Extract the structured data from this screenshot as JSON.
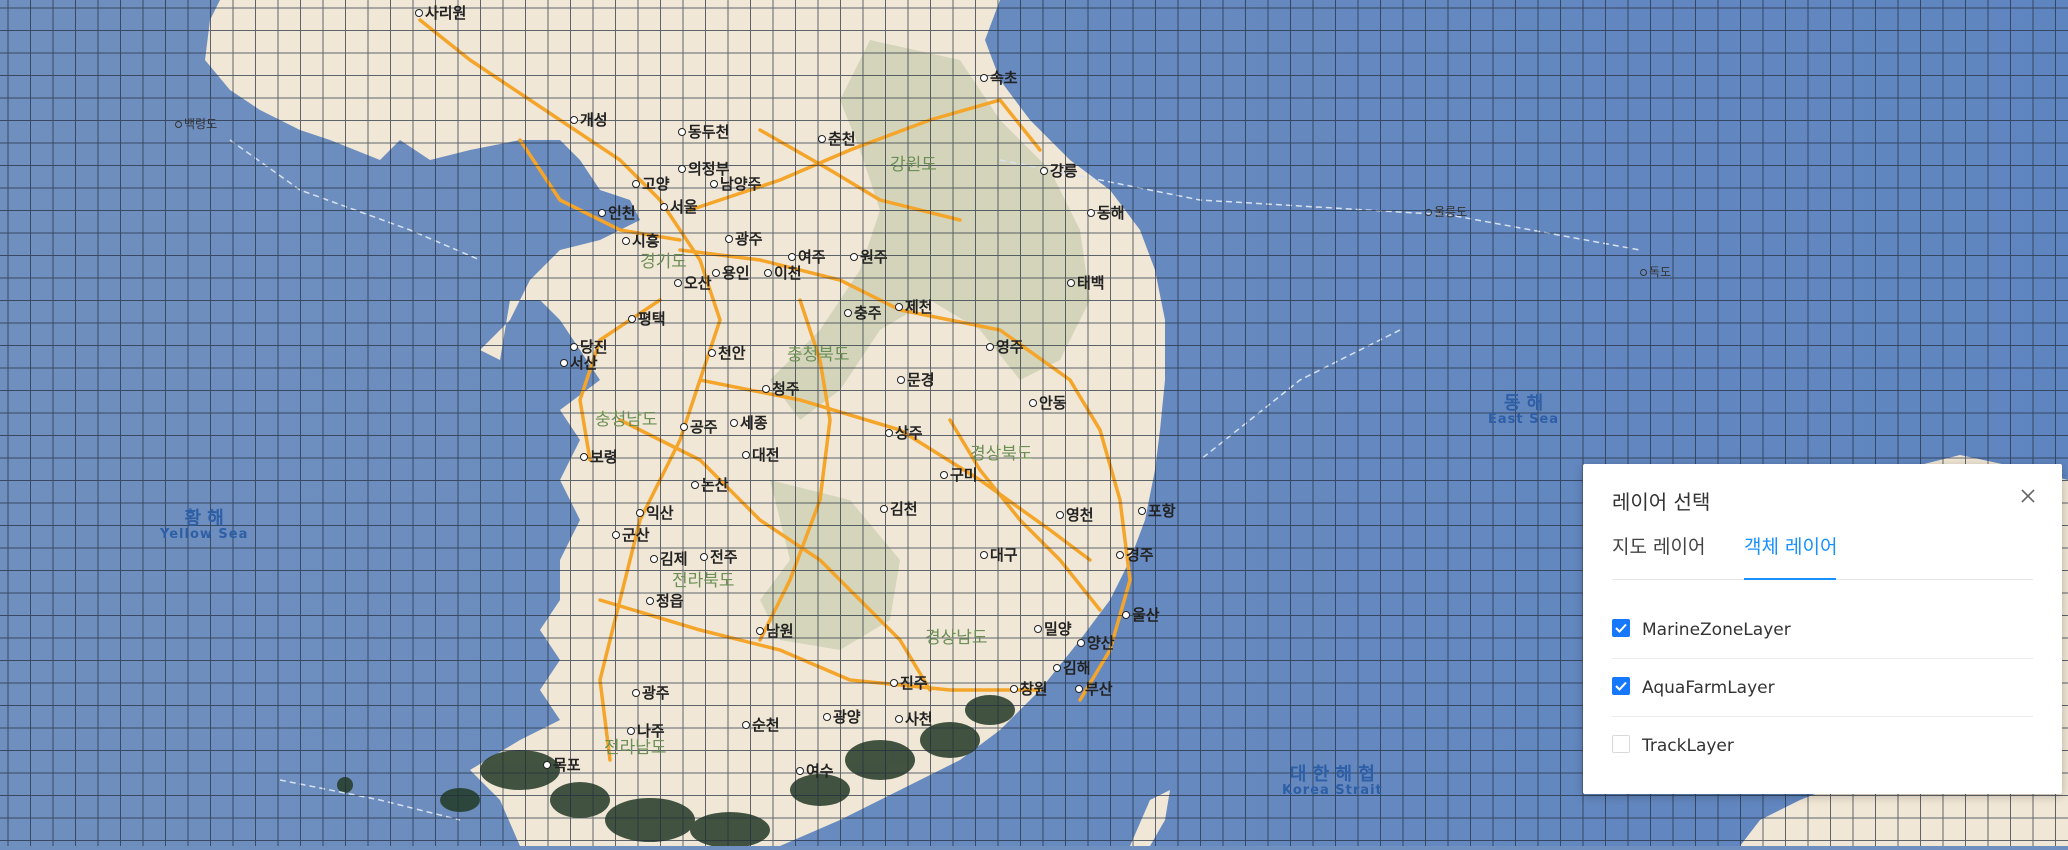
{
  "map": {
    "cities": [
      {
        "name": "사리원"
      },
      {
        "name": "개성"
      },
      {
        "name": "동두천"
      },
      {
        "name": "춘천"
      },
      {
        "name": "속초"
      },
      {
        "name": "의정부"
      },
      {
        "name": "고양"
      },
      {
        "name": "남양주"
      },
      {
        "name": "강릉"
      },
      {
        "name": "인천"
      },
      {
        "name": "서울"
      },
      {
        "name": "동해"
      },
      {
        "name": "시흥"
      },
      {
        "name": "광주"
      },
      {
        "name": "여주"
      },
      {
        "name": "원주"
      },
      {
        "name": "오산"
      },
      {
        "name": "용인"
      },
      {
        "name": "이천"
      },
      {
        "name": "태백"
      },
      {
        "name": "평택"
      },
      {
        "name": "충주"
      },
      {
        "name": "제천"
      },
      {
        "name": "당진"
      },
      {
        "name": "천안"
      },
      {
        "name": "영주"
      },
      {
        "name": "서산"
      },
      {
        "name": "청주"
      },
      {
        "name": "문경"
      },
      {
        "name": "안동"
      },
      {
        "name": "공주"
      },
      {
        "name": "세종"
      },
      {
        "name": "대전"
      },
      {
        "name": "상주"
      },
      {
        "name": "보령"
      },
      {
        "name": "논산"
      },
      {
        "name": "구미"
      },
      {
        "name": "익산"
      },
      {
        "name": "김천"
      },
      {
        "name": "영천"
      },
      {
        "name": "포항"
      },
      {
        "name": "군산"
      },
      {
        "name": "김제"
      },
      {
        "name": "전주"
      },
      {
        "name": "대구"
      },
      {
        "name": "경주"
      },
      {
        "name": "정읍"
      },
      {
        "name": "울산"
      },
      {
        "name": "남원"
      },
      {
        "name": "밀양"
      },
      {
        "name": "양산"
      },
      {
        "name": "광주"
      },
      {
        "name": "진주"
      },
      {
        "name": "김해"
      },
      {
        "name": "창원"
      },
      {
        "name": "부산"
      },
      {
        "name": "나주"
      },
      {
        "name": "순천"
      },
      {
        "name": "광양"
      },
      {
        "name": "사천"
      },
      {
        "name": "목포"
      },
      {
        "name": "여수"
      }
    ],
    "provinces": [
      {
        "name": "강원도"
      },
      {
        "name": "경기도"
      },
      {
        "name": "충청북도"
      },
      {
        "name": "충청남도"
      },
      {
        "name": "경상북도"
      },
      {
        "name": "전라북도"
      },
      {
        "name": "경상남도"
      },
      {
        "name": "전라남도"
      }
    ],
    "seas": [
      {
        "ko": "황 해",
        "en": "Yellow Sea"
      },
      {
        "ko": "동 해",
        "en": "East Sea"
      },
      {
        "ko": "대 한 해 협",
        "en": "Korea Strait"
      }
    ],
    "islands": [
      {
        "name": "울릉도"
      },
      {
        "name": "독도"
      },
      {
        "name": "백령도"
      }
    ],
    "colors": {
      "sea": "#6e8fbf",
      "land": "#f2ead9",
      "grid": "#1f2a3a",
      "road": "#f5a623",
      "highway": "#1f5fbf"
    }
  },
  "panel": {
    "title": "레이어 선택",
    "close_icon": "close-icon",
    "tabs": [
      {
        "label": "지도 레이어",
        "active": false
      },
      {
        "label": "객체 레이어",
        "active": true
      }
    ],
    "layers": [
      {
        "label": "MarineZoneLayer",
        "checked": true
      },
      {
        "label": "AquaFarmLayer",
        "checked": true
      },
      {
        "label": "TrackLayer",
        "checked": false
      }
    ]
  }
}
